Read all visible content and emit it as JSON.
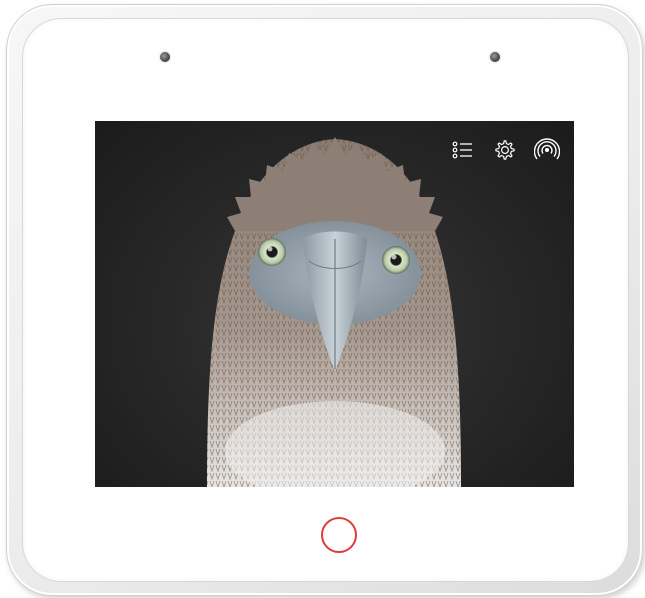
{
  "device": {
    "frame_color": "#f2f2f2",
    "accent_color": "#e03a3a",
    "screen_background": "#2a2929"
  },
  "screen": {
    "content": "blue-footed-booby-photo",
    "toolbar_icons": [
      "list-icon",
      "gear-icon",
      "broadcast-icon"
    ]
  },
  "hardware": {
    "home_button": "home-ring-button",
    "sensors": [
      "camera-sensor-left",
      "camera-sensor-right"
    ]
  }
}
